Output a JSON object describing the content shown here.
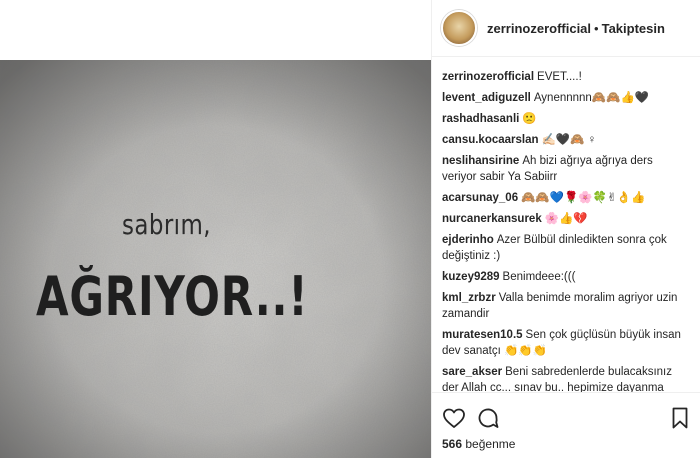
{
  "header": {
    "username": "zerrinozerofficial",
    "separator": "•",
    "follow_status": "Takiptesin"
  },
  "post_image": {
    "line1": "sabrım,",
    "line2": "AĞRIYOR..!"
  },
  "comments": [
    {
      "user": "zerrinozerofficial",
      "text": "EVET....!"
    },
    {
      "user": "levent_adiguzell",
      "text": "Aynennnnn🙈🙈👍🖤"
    },
    {
      "user": "rashadhasanli",
      "text": "🙁"
    },
    {
      "user": "cansu.kocaarslan",
      "text": "✍🏻🖤🙈 ♀"
    },
    {
      "user": "neslihansirine",
      "text": "Ah bizi ağrıya ağrıya ders veriyor sabir Ya Sabiirr"
    },
    {
      "user": "acarsunay_06",
      "text": "🙈🙈💙🌹🌸🍀✌👌👍"
    },
    {
      "user": "nurcanerkansurek",
      "text": "🌸👍💔"
    },
    {
      "user": "ejderinho",
      "text": "Azer Bülbül dinledikten sonra çok değiştiniz :)"
    },
    {
      "user": "kuzey9289",
      "text": "Benimdeee:((("
    },
    {
      "user": "kml_zrbzr",
      "text": "Valla benimde moralim agriyor uzin zamandir"
    },
    {
      "user": "muratesen10.5",
      "text": "Sen çok güçlüsün büyük insan dev sanatçı 👏👏👏"
    },
    {
      "user": "sare_akser",
      "text": "Beni sabredenlerde bulacaksınız der Allah cc... sınav bu.. hepimize dayanma"
    }
  ],
  "likes": {
    "count": "566",
    "label": "beğenme"
  },
  "icons": {
    "like": "heart-icon",
    "comment": "comment-icon",
    "save": "bookmark-icon"
  }
}
